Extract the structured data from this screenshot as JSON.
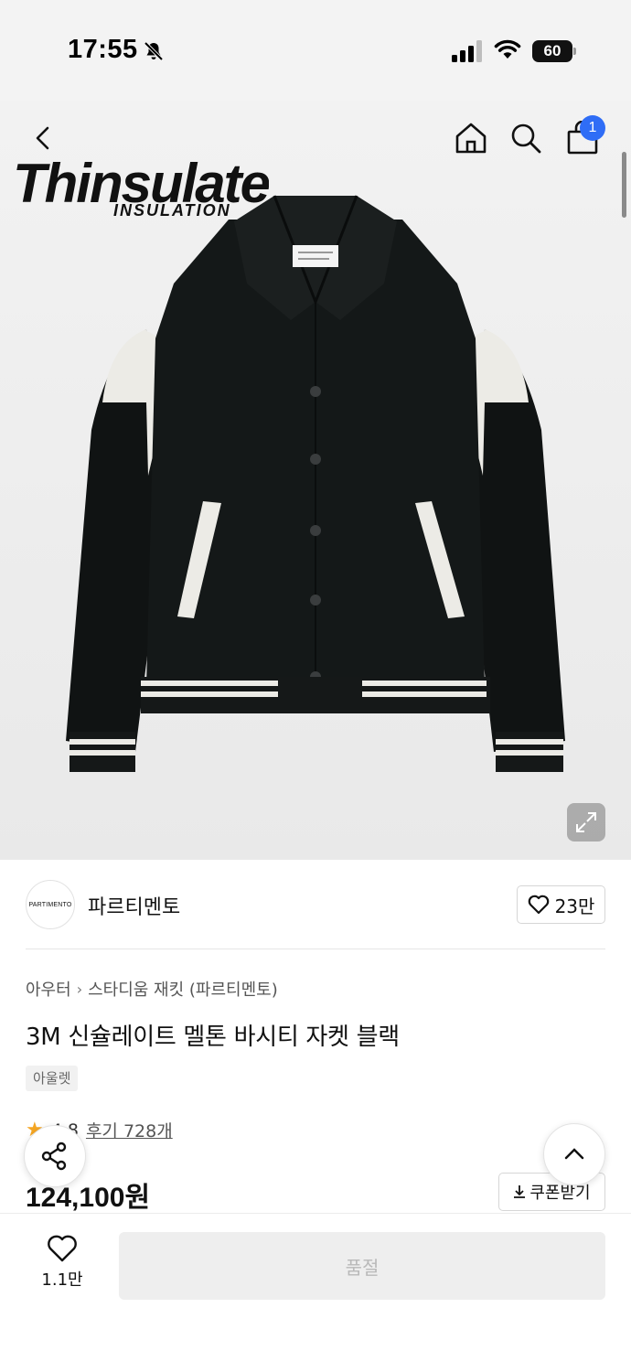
{
  "status_bar": {
    "time": "17:55",
    "battery": "60",
    "icons": [
      "bell-slash-icon",
      "cellular-signal-icon",
      "wifi-icon",
      "battery-icon"
    ]
  },
  "header": {
    "icons": [
      "back-chevron-icon",
      "home-icon",
      "search-icon",
      "shopping-bag-icon"
    ],
    "cart_count": "1"
  },
  "hero": {
    "logo_text": "Thinsulate",
    "logo_subtext": "INSULATION",
    "expand_icon": "expand-icon"
  },
  "brand": {
    "avatar_text": "PARTIMENTO",
    "name": "파르티멘토",
    "likes": "23만"
  },
  "product": {
    "breadcrumb": [
      "아우터",
      "스타디움 재킷 (파르티멘토)"
    ],
    "title": "3M 신슐레이트 멜톤 바시티 자켓 블랙",
    "tag": "아울렛",
    "rating": "4.8",
    "reviews": "후기 728개",
    "price": "124,100원",
    "coupon_label": "쿠폰받기"
  },
  "bottom_bar": {
    "wish_count": "1.1만",
    "buy_label": "품절"
  },
  "colors": {
    "accent_badge": "#2f6df6",
    "star": "#f5a623",
    "disabled_button": "#eeeeee",
    "disabled_text": "#b9b9b9"
  }
}
